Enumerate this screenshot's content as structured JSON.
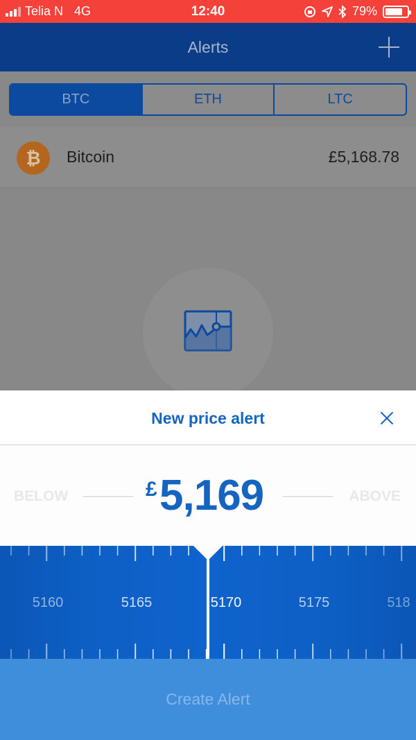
{
  "status_bar": {
    "carrier": "Telia N",
    "network": "4G",
    "time": "12:40",
    "battery": "79%",
    "battery_level": 0.79
  },
  "nav": {
    "title": "Alerts"
  },
  "tabs": [
    {
      "label": "BTC",
      "active": true
    },
    {
      "label": "ETH",
      "active": false
    },
    {
      "label": "LTC",
      "active": false
    }
  ],
  "coin": {
    "icon_symbol": "₿",
    "name": "Bitcoin",
    "price": "£5,168.78"
  },
  "sheet": {
    "title": "New price alert",
    "below_label": "BELOW",
    "above_label": "ABOVE",
    "currency": "£",
    "value": "5,169"
  },
  "ruler": {
    "labels": [
      "5160",
      "5165",
      "5170",
      "5175",
      "518"
    ]
  },
  "create_button": {
    "label": "Create Alert"
  },
  "colors": {
    "status_bar": "#f4413a",
    "nav_bar": "#0a3c87",
    "accent": "#1565c0",
    "ruler": "#0e63cc",
    "create_button": "#3f8edc"
  }
}
